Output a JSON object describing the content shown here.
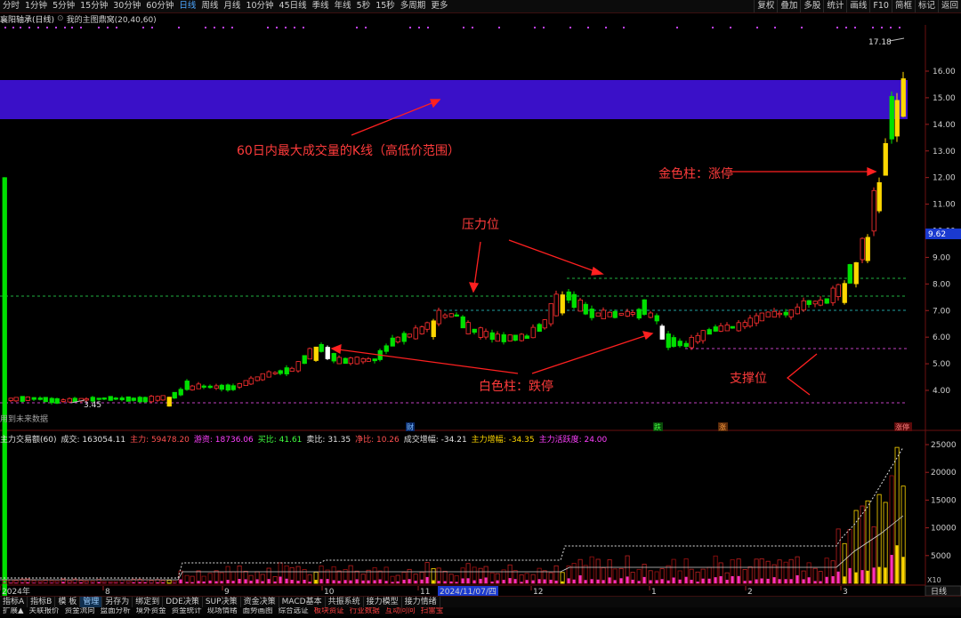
{
  "toolbar": {
    "periods": [
      "分时",
      "1分钟",
      "5分钟",
      "15分钟",
      "30分钟",
      "60分钟",
      "日线",
      "周线",
      "月线",
      "10分钟",
      "45日线",
      "季线",
      "年线",
      "5秒",
      "15秒",
      "多周期",
      "更多"
    ],
    "active_period": "日线",
    "tools": [
      "复权",
      "叠加",
      "多股",
      "统计",
      "画线",
      "F10",
      "简框",
      "标记",
      "返回"
    ]
  },
  "title": {
    "stock": "襄阳轴承(日线)",
    "indicator": "我的主图鼎窝(20,40,60)"
  },
  "price_axis": {
    "ticks": [
      "16.00",
      "15.00",
      "14.00",
      "13.00",
      "12.00",
      "11.00",
      "10.00",
      "9.00",
      "8.00",
      "7.00",
      "6.00",
      "5.00",
      "4.00"
    ],
    "high_label": "17.18",
    "low_label": "3.45",
    "current_label": "9.62"
  },
  "volume_axis": {
    "ticks": [
      "25000",
      "20000",
      "15000",
      "10000",
      "5000"
    ],
    "unit": "X10"
  },
  "volume_header": {
    "name": "主力交易额(60)",
    "items": [
      {
        "label": "成交:",
        "value": "163054.11",
        "color": "#e0e0e0"
      },
      {
        "label": "主力:",
        "value": "59478.20",
        "color": "#ff5050"
      },
      {
        "label": "游资:",
        "value": "18736.06",
        "color": "#ff40ff"
      },
      {
        "label": "买比:",
        "value": "41.61",
        "color": "#40ff40"
      },
      {
        "label": "卖比:",
        "value": "31.35",
        "color": "#e0e0e0"
      },
      {
        "label": "净比:",
        "value": "10.26",
        "color": "#ff5050"
      },
      {
        "label": "成交增幅:",
        "value": "-34.21",
        "color": "#e0e0e0"
      },
      {
        "label": "主力增幅:",
        "value": "-34.35",
        "color": "#ffd700"
      },
      {
        "label": "主力活跃度:",
        "value": "24.00",
        "color": "#ff40ff"
      }
    ]
  },
  "date_axis": {
    "labels": [
      "2024年",
      "8",
      "9",
      "10",
      "11",
      "2024/11/07/四",
      "12",
      "1",
      "2",
      "3"
    ],
    "right_button": "日线"
  },
  "markers": {
    "cai": "财",
    "die": "跌",
    "zhang": "涨",
    "zhangting": "涨停"
  },
  "note_no_future": "用到未来数据",
  "annotations": {
    "max_volume_band": "60日内最大成交量的K线（高低价范围）",
    "gold_bar": "金色柱：涨停",
    "pressure": "压力位",
    "white_bar": "白色柱：跌停",
    "support": "支撑位"
  },
  "bottom_tabs": [
    "指标A",
    "指标B",
    "模 板",
    "管理",
    "另存为",
    "绑定到",
    "DDE决策",
    "SUP决策",
    "资金决策",
    "MACD基本",
    "共振系统",
    "接力模型",
    "接力情绪"
  ],
  "active_bottom_tab": "管理",
  "bottom_tabs2": [
    "扩展▲",
    "关联报价",
    "资金流向",
    "盘面分析",
    "境外资金",
    "资金统计",
    "现场情绪",
    "面势画图",
    "综合选证",
    "板块资证",
    "行业数据",
    "互动问问",
    "扫雷宝"
  ],
  "colors": {
    "up": "#ff3030",
    "down": "#00e000",
    "limit_up": "#ffd700",
    "limit_down": "#ffffff",
    "band": "#3a10c8",
    "annotation": "#ff3b3b"
  }
}
